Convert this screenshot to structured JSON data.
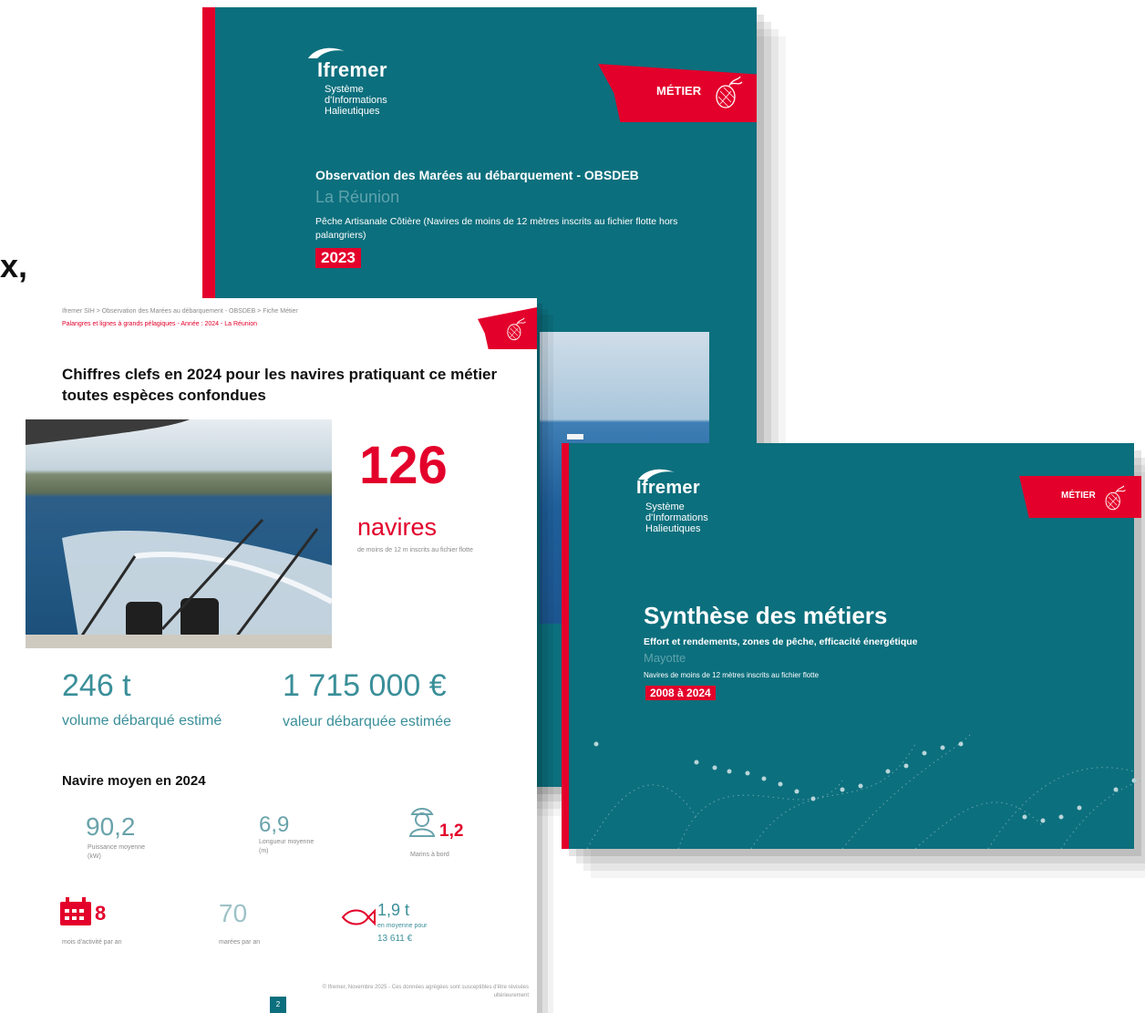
{
  "stray_glyph": "x,",
  "back_cover": {
    "logo_name": "Ifremer",
    "logo_sub": [
      "Système",
      "d'Informations",
      "Halieutiques"
    ],
    "flag_label": "MÉTIER",
    "title": "Observation des Marées au débarquement - OBSDEB",
    "region": "La Réunion",
    "description": "Pêche Artisanale Côtière (Navires de moins de 12 mètres inscrits au fichier flotte hors palangriers)",
    "year": "2023"
  },
  "sheet": {
    "breadcrumb": "Ifremer SIH > Observation des Marées au débarquement - OBSDEB > Fiche Métier",
    "subtitle": "Palangres et lignes à grands pélagiques - Année : 2024 - La Réunion",
    "heading": "Chiffres clefs en 2024 pour les navires pratiquant ce métier toutes espèces confondues",
    "navires_count": "126",
    "navires_label": "navires",
    "navires_note": "de moins de 12 m inscrits au fichier flotte",
    "volume_value": "246 t",
    "volume_label": "volume débarqué estimé",
    "valeur_value": "1 715 000 €",
    "valeur_label": "valeur débarquée estimée",
    "avg_heading": "Navire moyen en 2024",
    "puissance_value": "90,2",
    "puissance_label": "Puissance moyenne (kW)",
    "longueur_value": "6,9",
    "longueur_label": "Longueur moyenne (m)",
    "marins_value": "1,2",
    "marins_label": "Marins à bord",
    "mois_value": "8",
    "mois_label": "mois d'activité par an",
    "marees_value": "70",
    "marees_label": "marées par an",
    "capture_value": "1,9 t",
    "capture_label": "en moyenne pour",
    "capture_money": "13 611 €",
    "footer": "© Ifremer, Novembre 2025 - Ces données agrégées sont susceptibles d'être révisées ultérieurement",
    "page_number": "2"
  },
  "right_cover": {
    "logo_name": "Ifremer",
    "logo_sub": [
      "Système",
      "d'Informations",
      "Halieutiques"
    ],
    "flag_label": "MÉTIER",
    "title": "Synthèse des métiers",
    "subtitle": "Effort et rendements, zones de pêche, efficacité énergétique",
    "region": "Mayotte",
    "description": "Navires de moins de 12 mètres inscrits au fichier flotte",
    "years": "2008 à 2024"
  },
  "colors": {
    "teal": "#0c6f7d",
    "red": "#e3002b",
    "number_teal": "#3a8f99"
  }
}
